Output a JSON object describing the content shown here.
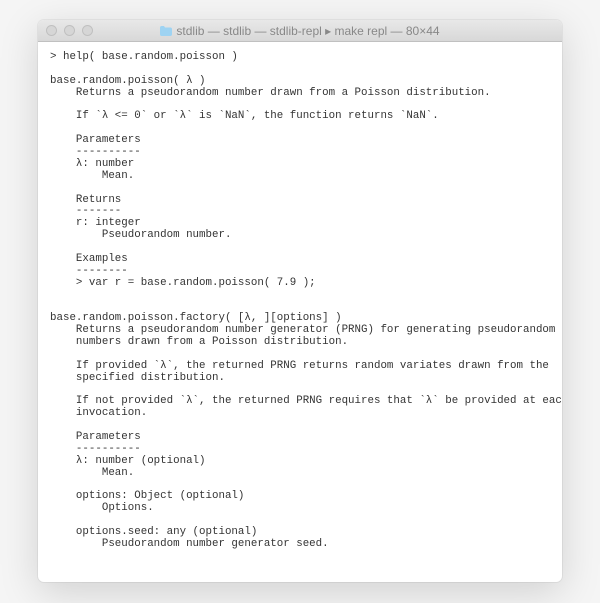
{
  "window": {
    "title": "stdlib — stdlib — stdlib-repl ▸ make repl — 80×44"
  },
  "terminal": {
    "prompt": "> ",
    "command": "help( base.random.poisson )",
    "doc1": {
      "sig": "base.random.poisson( λ )",
      "desc": "Returns a pseudorandom number drawn from a Poisson distribution.",
      "note": "If `λ <= 0` or `λ` is `NaN`, the function returns `NaN`.",
      "params_header": "Parameters",
      "params_underline": "----------",
      "param1_name": "λ: number",
      "param1_desc": "Mean.",
      "returns_header": "Returns",
      "returns_underline": "-------",
      "return_name": "r: integer",
      "return_desc": "Pseudorandom number.",
      "examples_header": "Examples",
      "examples_underline": "--------",
      "example_line": "> var r = base.random.poisson( 7.9 );"
    },
    "doc2": {
      "sig": "base.random.poisson.factory( [λ, ][options] )",
      "desc1": "Returns a pseudorandom number generator (PRNG) for generating pseudorandom",
      "desc2": "numbers drawn from a Poisson distribution.",
      "note1a": "If provided `λ`, the returned PRNG returns random variates drawn from the",
      "note1b": "specified distribution.",
      "note2a": "If not provided `λ`, the returned PRNG requires that `λ` be provided at each",
      "note2b": "invocation.",
      "params_header": "Parameters",
      "params_underline": "----------",
      "param1_name": "λ: number (optional)",
      "param1_desc": "Mean.",
      "param2_name": "options: Object (optional)",
      "param2_desc": "Options.",
      "param3_name": "options.seed: any (optional)",
      "param3_desc": "Pseudorandom number generator seed."
    }
  }
}
